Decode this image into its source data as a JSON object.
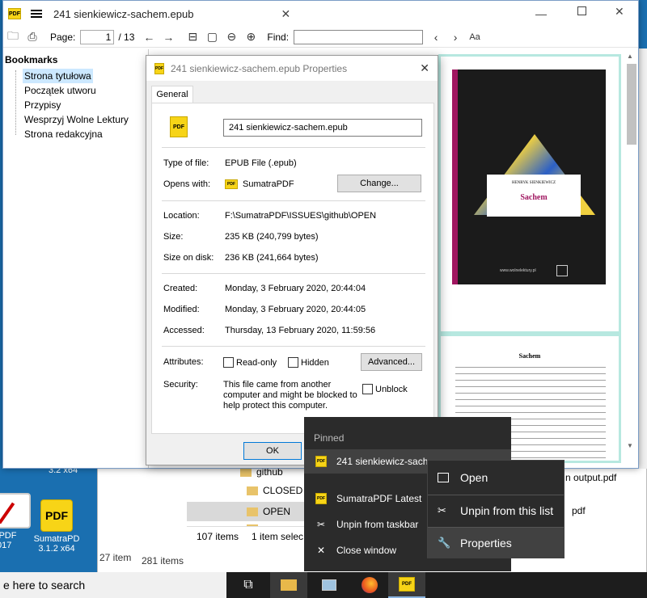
{
  "desktop": {
    "icons": [
      {
        "label": "iPDF\n017"
      },
      {
        "label": "SumatraPD\n3.1.2 x64"
      }
    ],
    "behind_label": "3.2 x64"
  },
  "explorer": {
    "folders": [
      "github",
      "CLOSED",
      "OPEN"
    ],
    "status_items": "107 items",
    "status_selected": "1 item selec",
    "status2": "27 item",
    "status3": "281 items",
    "right_file": "n output.pdf",
    "right_file2": "pdf"
  },
  "sumatra": {
    "title": "241 sienkiewicz-sachem.epub",
    "toolbar": {
      "page_label": "Page:",
      "page_value": "1",
      "page_total": "/ 13",
      "find_label": "Find:"
    },
    "bookmarks": {
      "header": "Bookmarks",
      "items": [
        "Strona tytułowa",
        "Początek utworu",
        "Przypisy",
        "Wesprzyj Wolne Lektury",
        "Strona redakcyjna"
      ]
    },
    "book": {
      "author": "HENRYK SIENKIEWICZ",
      "cover_title": "Sachem",
      "site": "www.wolnelektury.pl",
      "heading": "Sachem"
    }
  },
  "dialog": {
    "title": "241 sienkiewicz-sachem.epub Properties",
    "tab": "General",
    "filename": "241 sienkiewicz-sachem.epub",
    "type_label": "Type of file:",
    "type_value": "EPUB File (.epub)",
    "opens_label": "Opens with:",
    "opens_value": "SumatraPDF",
    "change_button": "Change...",
    "location_label": "Location:",
    "location_value": "F:\\SumatraPDF\\ISSUES\\github\\OPEN",
    "size_label": "Size:",
    "size_value": "235 KB (240,799 bytes)",
    "disk_label": "Size on disk:",
    "disk_value": "236 KB (241,664 bytes)",
    "created_label": "Created:",
    "created_value": "Monday, 3 February 2020, 20:44:04",
    "modified_label": "Modified:",
    "modified_value": "Monday, 3 February 2020, 20:44:05",
    "accessed_label": "Accessed:",
    "accessed_value": "Thursday, 13 February 2020, 11:59:56",
    "attributes_label": "Attributes:",
    "readonly_label": "Read-only",
    "hidden_label": "Hidden",
    "advanced_button": "Advanced...",
    "security_label": "Security:",
    "security_text": "This file came from another computer and might be blocked to help protect this computer.",
    "unblock_label": "Unblock",
    "ok_button": "OK"
  },
  "jumplist": {
    "section": "Pinned",
    "pinned_item": "241 sienkiewicz-sach",
    "app_item": "SumatraPDF Latest",
    "unpin": "Unpin from taskbar",
    "close": "Close window"
  },
  "context_menu": {
    "open": "Open",
    "unpin_list": "Unpin from this list",
    "properties": "Properties"
  },
  "taskbar": {
    "search": "e here to search"
  },
  "colors": {
    "desktop": "#1a6fb0",
    "taskbar": "#1d1d1d",
    "jumplist": "#2b2b2b",
    "selection": "#cce8ff",
    "page_border": "#b7e8e0",
    "pdf_yellow": "#f7d417"
  }
}
